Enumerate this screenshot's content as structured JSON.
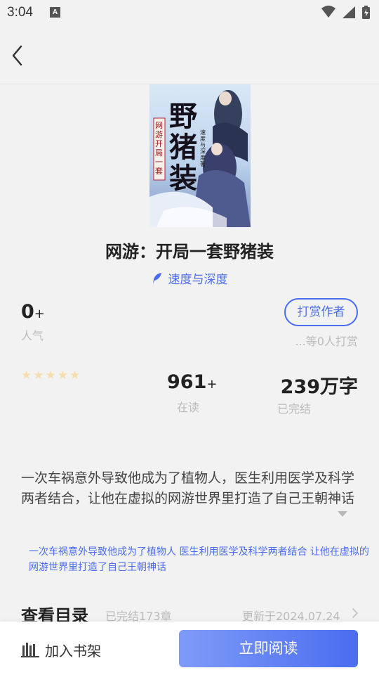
{
  "status_bar": {
    "time": "3:04",
    "notification_letter": "A"
  },
  "book": {
    "title": "网游：开局一套野猪装",
    "author": "速度与深度",
    "popularity": "0",
    "popularity_suffix": "+",
    "popularity_label": "人气",
    "tip_button": "打赏作者",
    "tip_count": "...等0人打赏",
    "rating_stars": 5,
    "reading": "961",
    "reading_suffix": "+",
    "reading_label": "在读",
    "words": "239万字",
    "status": "已完结",
    "synopsis": "一次车祸意外导致他成为了植物人，医生利用医学及科学两者结合，让他在虚拟的网游世界里打造了自己王朝神话",
    "tag_line": "一次车祸意外导致他成为了植物人 医生利用医学及科学两者结合 让他在虚拟的网游世界里打造了自己王朝神话"
  },
  "catalog": {
    "title": "查看目录",
    "chapters": "已完结173章",
    "updated": "更新于2024.07.24"
  },
  "bottom_bar": {
    "shelf_label": "加入书架",
    "read_label": "立即阅读"
  },
  "cover": {
    "big_title": "野猪装",
    "side_title": "网游开局一套",
    "author_small": "速度与深度著"
  },
  "colors": {
    "accent": "#4a6df0",
    "muted": "#bbbbbb",
    "star": "#f5dfae"
  }
}
